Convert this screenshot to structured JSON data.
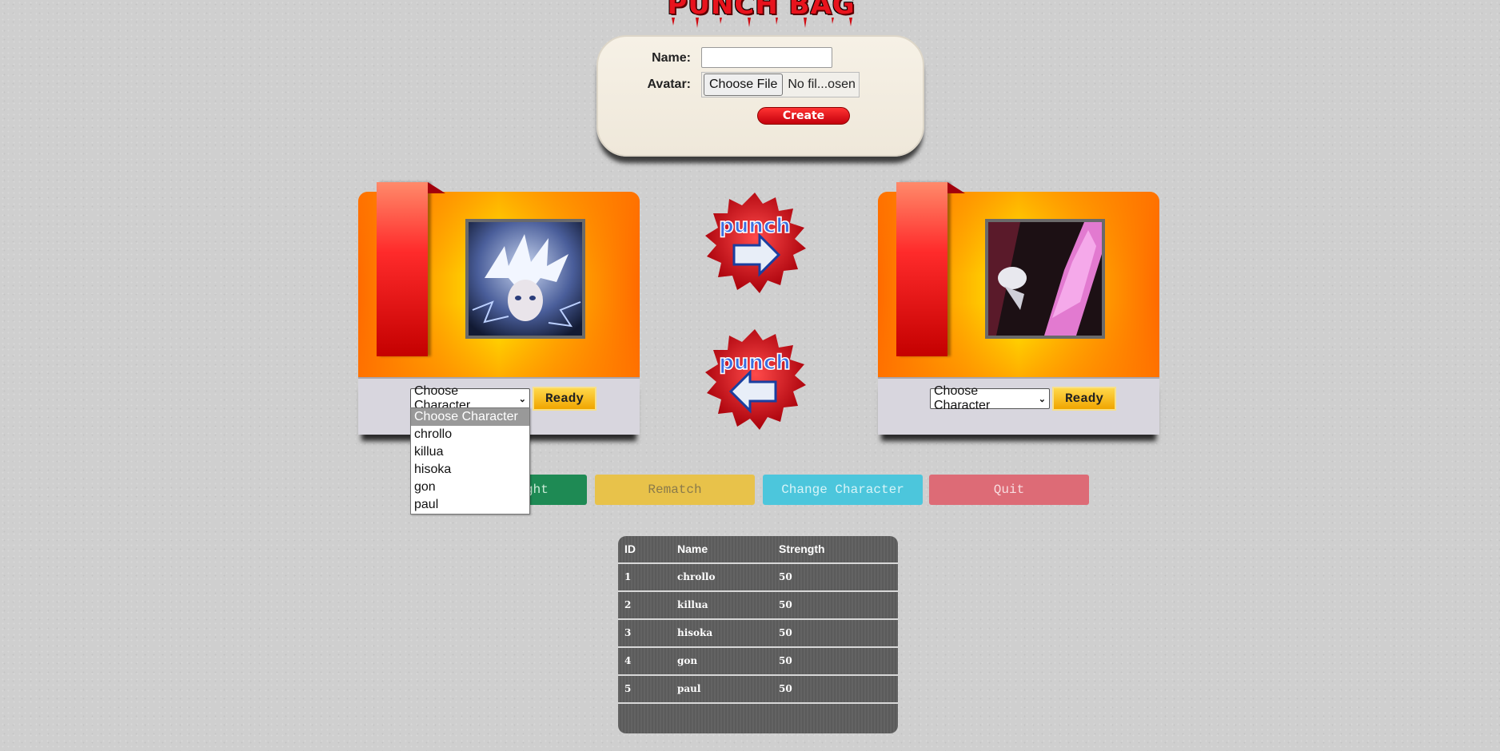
{
  "app": {
    "logo_text": "PUNCH BAG"
  },
  "create_form": {
    "name_label": "Name:",
    "name_value": "",
    "avatar_label": "Avatar:",
    "choose_file_label": "Choose File",
    "file_status": "No fil...osen",
    "create_label": "Create"
  },
  "player1": {
    "select_value": "Choose Character",
    "ready_label": "Ready",
    "dropdown_open": true
  },
  "player2": {
    "select_value": "Choose Character",
    "ready_label": "Ready"
  },
  "character_options": [
    "Choose Character",
    "chrollo",
    "killua",
    "hisoka",
    "gon",
    "paul"
  ],
  "punch_buttons": {
    "right_text": "punch",
    "left_text": "punch"
  },
  "actions": {
    "fight_label": "Fight",
    "fight_visible_text": "ght",
    "rematch_label": "Rematch",
    "change_character_label": "Change Character",
    "quit_label": "Quit"
  },
  "table": {
    "headers": [
      "ID",
      "Name",
      "Strength"
    ],
    "rows": [
      [
        "1",
        "chrollo",
        "50"
      ],
      [
        "2",
        "killua",
        "50"
      ],
      [
        "3",
        "hisoka",
        "50"
      ],
      [
        "4",
        "gon",
        "50"
      ],
      [
        "5",
        "paul",
        "50"
      ]
    ]
  },
  "colors": {
    "background": "#cfcfcf",
    "fight": "#1e8a54",
    "rematch": "#e8c24a",
    "change_character": "#4cc6dc",
    "quit": "#dd6b76",
    "create": "#e8101a"
  },
  "icons": {
    "punch_right": "arrow-right-icon",
    "punch_left": "arrow-left-icon"
  }
}
